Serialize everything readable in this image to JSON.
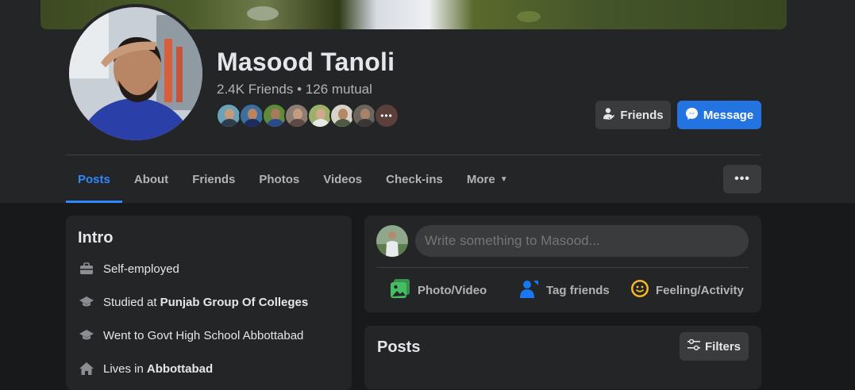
{
  "profile": {
    "name": "Masood Tanoli",
    "friends_summary": "2.4K Friends • 126 mutual",
    "mutual_more": "•••"
  },
  "actions": {
    "friends_label": "Friends",
    "message_label": "Message"
  },
  "tabs": [
    {
      "label": "Posts"
    },
    {
      "label": "About"
    },
    {
      "label": "Friends"
    },
    {
      "label": "Photos"
    },
    {
      "label": "Videos"
    },
    {
      "label": "Check-ins"
    },
    {
      "label": "More"
    }
  ],
  "tab_overflow": "•••",
  "intro": {
    "title": "Intro",
    "items": [
      {
        "icon": "briefcase-icon",
        "text": "Self-employed",
        "bold": ""
      },
      {
        "icon": "graduation-cap-icon",
        "text": "Studied at",
        "bold": "Punjab Group Of Colleges"
      },
      {
        "icon": "graduation-cap-icon",
        "text": "Went to Govt High School Abbottabad",
        "bold": ""
      },
      {
        "icon": "home-icon",
        "text": "Lives in",
        "bold": "Abbottabad"
      }
    ]
  },
  "composer": {
    "placeholder": "Write something to Masood...",
    "actions": [
      {
        "icon": "photo-video-icon",
        "label": "Photo/Video"
      },
      {
        "icon": "tag-friends-icon",
        "label": "Tag friends"
      },
      {
        "icon": "feeling-smiley-icon",
        "label": "Feeling/Activity"
      }
    ]
  },
  "posts": {
    "title": "Posts",
    "filters_label": "Filters"
  },
  "colors": {
    "background": "#18191a",
    "card": "#242526",
    "button_secondary": "#3a3b3c",
    "accent": "#2d88ff",
    "message_button": "#2374e1",
    "text_primary": "#e4e6eb",
    "text_secondary": "#b0b3b8",
    "photo_green": "#45bd62",
    "tag_blue": "#1877f2",
    "feeling_yellow": "#f7b928"
  }
}
